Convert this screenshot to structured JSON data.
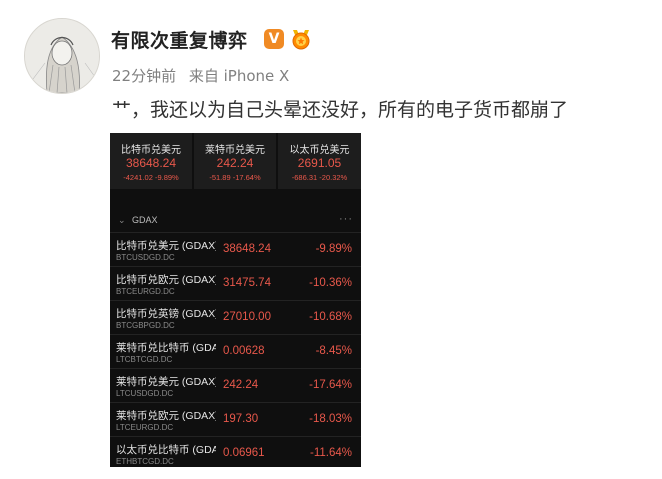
{
  "user": {
    "name": "有限次重复博弈",
    "verified_badge": "V",
    "medal_icon": "medal-icon"
  },
  "meta": {
    "time": "22分钟前",
    "source": "来自 iPhone X"
  },
  "post": {
    "text": "艹，我还以为自己头晕还没好，所有的电子货币都崩了"
  },
  "screenshot": {
    "tickers": [
      {
        "name": "比特币兑美元",
        "price": "38648.24",
        "change": "-4241.02  -9.89%"
      },
      {
        "name": "莱特币兑美元",
        "price": "242.24",
        "change": "-51.89  -17.64%"
      },
      {
        "name": "以太币兑美元",
        "price": "2691.05",
        "change": "-686.31  -20.32%"
      }
    ],
    "group": {
      "chevron": "⌄",
      "label": "GDAX",
      "more": "···"
    },
    "rows": [
      {
        "name": "比特币兑美元 (GDAX)",
        "symbol": "BTCUSDGD.DC",
        "price": "38648.24",
        "pct": "-9.89%"
      },
      {
        "name": "比特币兑欧元 (GDAX)",
        "symbol": "BTCEURGD.DC",
        "price": "31475.74",
        "pct": "-10.36%"
      },
      {
        "name": "比特币兑英镑 (GDAX)",
        "symbol": "BTCGBPGD.DC",
        "price": "27010.00",
        "pct": "-10.68%"
      },
      {
        "name": "莱特币兑比特币 (GDAX)",
        "symbol": "LTCBTCGD.DC",
        "price": "0.00628",
        "pct": "-8.45%"
      },
      {
        "name": "莱特币兑美元 (GDAX)",
        "symbol": "LTCUSDGD.DC",
        "price": "242.24",
        "pct": "-17.64%"
      },
      {
        "name": "莱特币兑欧元 (GDAX)",
        "symbol": "LTCEURGD.DC",
        "price": "197.30",
        "pct": "-18.03%"
      },
      {
        "name": "以太币兑比特币 (GDAX)",
        "symbol": "ETHBTCGD.DC",
        "price": "0.06961",
        "pct": "-11.64%"
      }
    ]
  }
}
